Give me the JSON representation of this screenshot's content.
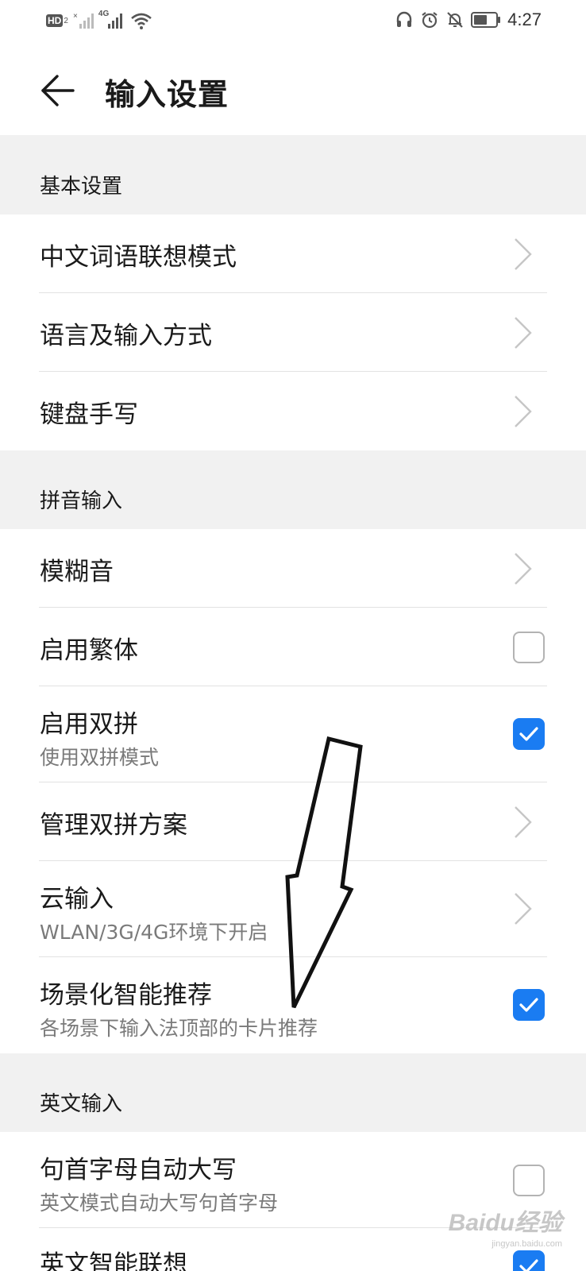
{
  "status_bar": {
    "hd_label": "HD",
    "hd_sub": "2",
    "network_label": "4G",
    "time": "4:27"
  },
  "app_bar": {
    "title": "输入设置"
  },
  "sections": {
    "basic": {
      "header": "基本设置",
      "items": [
        {
          "title": "中文词语联想模式"
        },
        {
          "title": "语言及输入方式"
        },
        {
          "title": "键盘手写"
        }
      ]
    },
    "pinyin": {
      "header": "拼音输入",
      "items": [
        {
          "title": "模糊音"
        },
        {
          "title": "启用繁体",
          "checked": false
        },
        {
          "title": "启用双拼",
          "subtitle": "使用双拼模式",
          "checked": true
        },
        {
          "title": "管理双拼方案"
        },
        {
          "title": "云输入",
          "subtitle": "WLAN/3G/4G环境下开启"
        },
        {
          "title": "场景化智能推荐",
          "subtitle": "各场景下输入法顶部的卡片推荐",
          "checked": true
        }
      ]
    },
    "english": {
      "header": "英文输入",
      "items": [
        {
          "title": "句首字母自动大写",
          "subtitle": "英文模式自动大写句首字母",
          "checked": false
        },
        {
          "title": "英文智能联想",
          "checked": true
        }
      ]
    }
  },
  "watermark": {
    "brand": "Baidu经验",
    "site": "jingyan.baidu.com"
  },
  "colors": {
    "accent": "#1a7cf2",
    "section_bg": "#f1f1f1"
  }
}
